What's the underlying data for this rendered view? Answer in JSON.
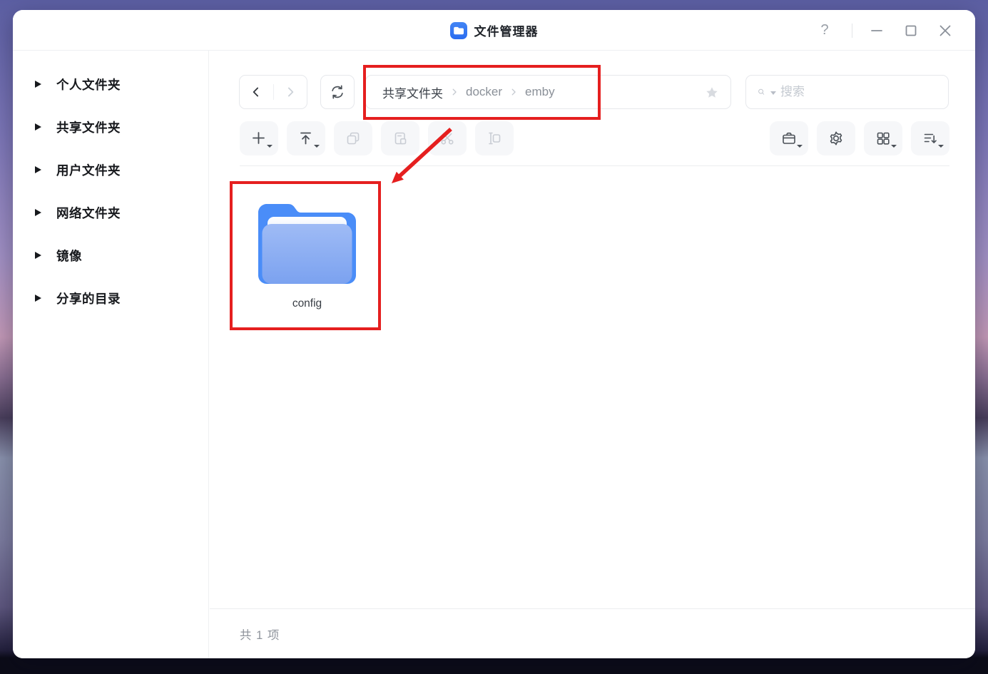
{
  "window": {
    "title": "文件管理器",
    "controls": {
      "help_label": "?"
    }
  },
  "sidebar": {
    "items": [
      {
        "label": "个人文件夹"
      },
      {
        "label": "共享文件夹"
      },
      {
        "label": "用户文件夹"
      },
      {
        "label": "网络文件夹"
      },
      {
        "label": "镜像"
      },
      {
        "label": "分享的目录"
      }
    ]
  },
  "toolbar": {
    "breadcrumb": {
      "segments": [
        "共享文件夹",
        "docker",
        "emby"
      ]
    },
    "search": {
      "placeholder": "搜索"
    }
  },
  "content": {
    "items": [
      {
        "name": "config",
        "type": "folder"
      }
    ]
  },
  "statusbar": {
    "text": "共 1 项"
  },
  "icons": {
    "titlebar": [
      "app-folder",
      "help",
      "minimize",
      "maximize",
      "close"
    ],
    "toolbar_left": [
      "new-plus",
      "upload",
      "copy",
      "paste",
      "cut-scissors",
      "rename"
    ],
    "toolbar_right": [
      "toolbox-briefcase",
      "settings-gear",
      "view-grid",
      "sort"
    ],
    "nav": [
      "back-chevron",
      "forward-chevron",
      "refresh",
      "favorite-star",
      "search-magnifier"
    ],
    "sidebar_expander": "triangle-right"
  },
  "colors": {
    "accent_blue": "#2b6cf0",
    "annotation_red": "#e51f1f",
    "folder_back": "#4a8df8",
    "folder_front_top": "#9fbbf5",
    "folder_front_bottom": "#7ba2f0",
    "disabled_icon": "#c9cdd4"
  }
}
